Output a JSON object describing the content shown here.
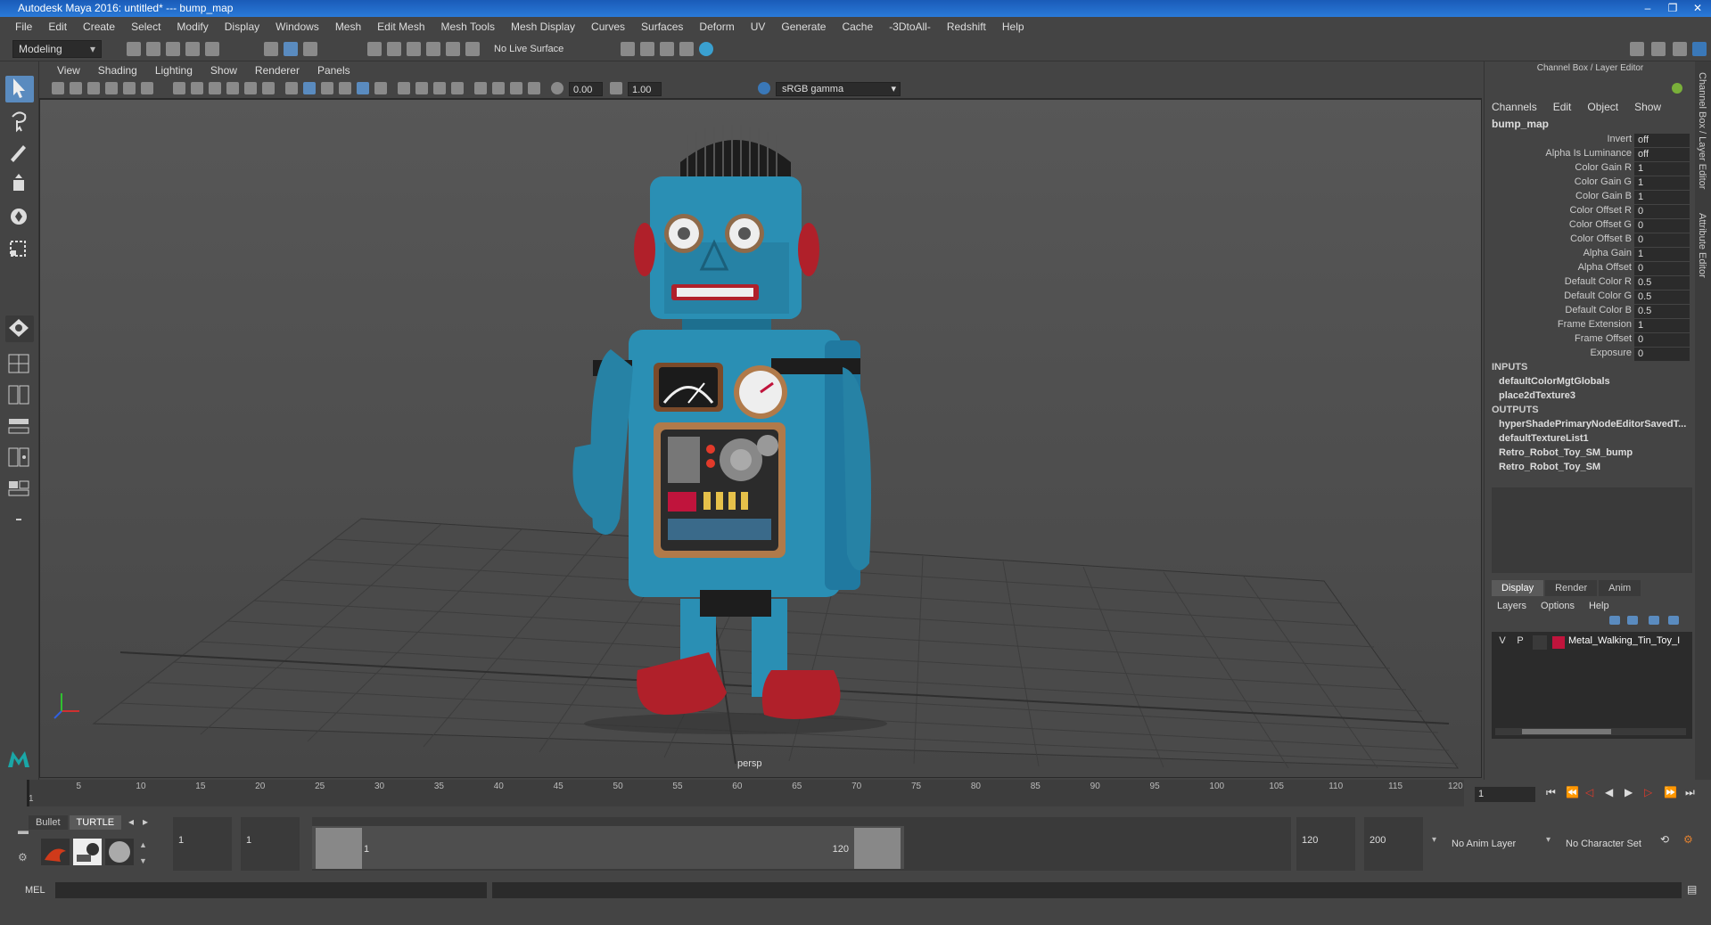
{
  "window": {
    "title": "Autodesk Maya 2016: untitled*   ---   bump_map",
    "controls": [
      "–",
      "❐",
      "✕"
    ]
  },
  "menubar": [
    "File",
    "Edit",
    "Create",
    "Select",
    "Modify",
    "Display",
    "Windows",
    "Mesh",
    "Edit Mesh",
    "Mesh Tools",
    "Mesh Display",
    "Curves",
    "Surfaces",
    "Deform",
    "UV",
    "Generate",
    "Cache",
    "-3DtoAll-",
    "Redshift",
    "Help"
  ],
  "statusline": {
    "mode": "Modeling",
    "live_surface": "No Live Surface"
  },
  "viewport": {
    "menu": [
      "View",
      "Shading",
      "Lighting",
      "Show",
      "Renderer",
      "Panels"
    ],
    "exposure": "0.00",
    "gamma": "1.00",
    "colorspace": "sRGB gamma",
    "camera": "persp"
  },
  "channelbox": {
    "title": "Channel Box / Layer Editor",
    "menu": [
      "Channels",
      "Edit",
      "Object",
      "Show"
    ],
    "node": "bump_map",
    "attributes": [
      {
        "label": "Invert",
        "value": "off"
      },
      {
        "label": "Alpha Is Luminance",
        "value": "off"
      },
      {
        "label": "Color Gain R",
        "value": "1"
      },
      {
        "label": "Color Gain G",
        "value": "1"
      },
      {
        "label": "Color Gain B",
        "value": "1"
      },
      {
        "label": "Color Offset R",
        "value": "0"
      },
      {
        "label": "Color Offset G",
        "value": "0"
      },
      {
        "label": "Color Offset B",
        "value": "0"
      },
      {
        "label": "Alpha Gain",
        "value": "1"
      },
      {
        "label": "Alpha Offset",
        "value": "0"
      },
      {
        "label": "Default Color R",
        "value": "0.5"
      },
      {
        "label": "Default Color G",
        "value": "0.5"
      },
      {
        "label": "Default Color B",
        "value": "0.5"
      },
      {
        "label": "Frame Extension",
        "value": "1"
      },
      {
        "label": "Frame Offset",
        "value": "0"
      },
      {
        "label": "Exposure",
        "value": "0"
      }
    ],
    "inputs_label": "INPUTS",
    "inputs": [
      "defaultColorMgtGlobals",
      "place2dTexture3"
    ],
    "outputs_label": "OUTPUTS",
    "outputs": [
      "hyperShadePrimaryNodeEditorSavedT...",
      "defaultTextureList1",
      "Retro_Robot_Toy_SM_bump",
      "Retro_Robot_Toy_SM"
    ]
  },
  "layers": {
    "tabs": [
      "Display",
      "Render",
      "Anim"
    ],
    "menu": [
      "Layers",
      "Options",
      "Help"
    ],
    "row": {
      "v": "V",
      "p": "P",
      "name": "Metal_Walking_Tin_Toy_I"
    }
  },
  "side_tabs": [
    "Channel Box / Layer Editor",
    "Attribute Editor"
  ],
  "timeline": {
    "ticks": [
      "1",
      "5",
      "10",
      "15",
      "20",
      "25",
      "30",
      "35",
      "40",
      "45",
      "50",
      "55",
      "60",
      "65",
      "70",
      "75",
      "80",
      "85",
      "90",
      "95",
      "100",
      "105",
      "110",
      "115",
      "120"
    ],
    "current_frame": "1"
  },
  "range": {
    "shelf_tabs": [
      "Bullet",
      "TURTLE"
    ],
    "start": "1",
    "inner_start": "1",
    "slider_start": "1",
    "slider_end": "120",
    "end": "120",
    "outer_end": "200",
    "anim_layer": "No Anim Layer",
    "char_set": "No Character Set"
  },
  "cmdline": {
    "label": "MEL"
  },
  "colors": {
    "accent": "#5a8bbf",
    "layer_color": "#c0143c"
  }
}
